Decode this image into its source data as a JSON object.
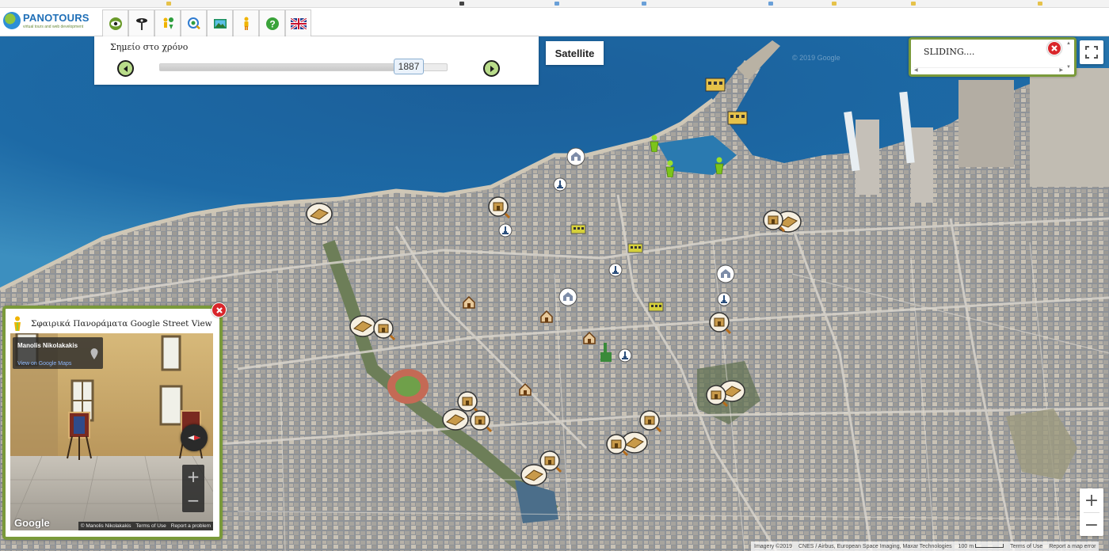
{
  "header": {
    "logo_text": "PANOTOURS",
    "logo_subtitle": "virtual tours and web development",
    "tools": [
      {
        "name": "tool-eye-icon"
      },
      {
        "name": "tool-camera-icon"
      },
      {
        "name": "tool-pegman-pin-icon"
      },
      {
        "name": "tool-search-location-icon"
      },
      {
        "name": "tool-picture-icon"
      },
      {
        "name": "tool-pegman-icon"
      },
      {
        "name": "tool-help-icon"
      },
      {
        "name": "tool-uk-flag-icon"
      }
    ]
  },
  "time_panel": {
    "label": "Σημείο στο χρόνο",
    "year": "1887",
    "slider_fraction": 0.92
  },
  "map_controls": {
    "satellite_label": "Satellite",
    "zoom_in": "+",
    "zoom_out": "−"
  },
  "sliding_box": {
    "text": "SLIDING...."
  },
  "attribution": {
    "imagery": "Imagery ©2019",
    "providers": "CNES / Airbus, European Space Imaging, Maxar Technologies",
    "scale": "100 m",
    "terms": "Terms of Use",
    "report": "Report a map error"
  },
  "street_view": {
    "title": "Σφαιρικά Πανοράματα Google Street View",
    "author": "Manolis Nikolakakis",
    "view_link": "View on Google Maps",
    "google": "Google",
    "footer_credit": "© Manolis Nikolakakis",
    "footer_terms": "Terms of Use",
    "footer_report": "Report a problem",
    "zoom_in": "+",
    "zoom_out": "−"
  },
  "colors": {
    "panel_border": "#7a9a3a",
    "close_red": "#d9262b",
    "sea": "#1f6fa6",
    "arrow_green": "#b9dc8a"
  },
  "markers": {
    "fortress_icon": "fortress-wall-icon",
    "gate_icon": "gate-icon",
    "church_icon": "church-icon",
    "fountain_icon": "fountain-icon",
    "house_icon": "house-icon",
    "pegman_icon": "green-pegman-icon",
    "building_icon": "yellow-building-icon"
  }
}
